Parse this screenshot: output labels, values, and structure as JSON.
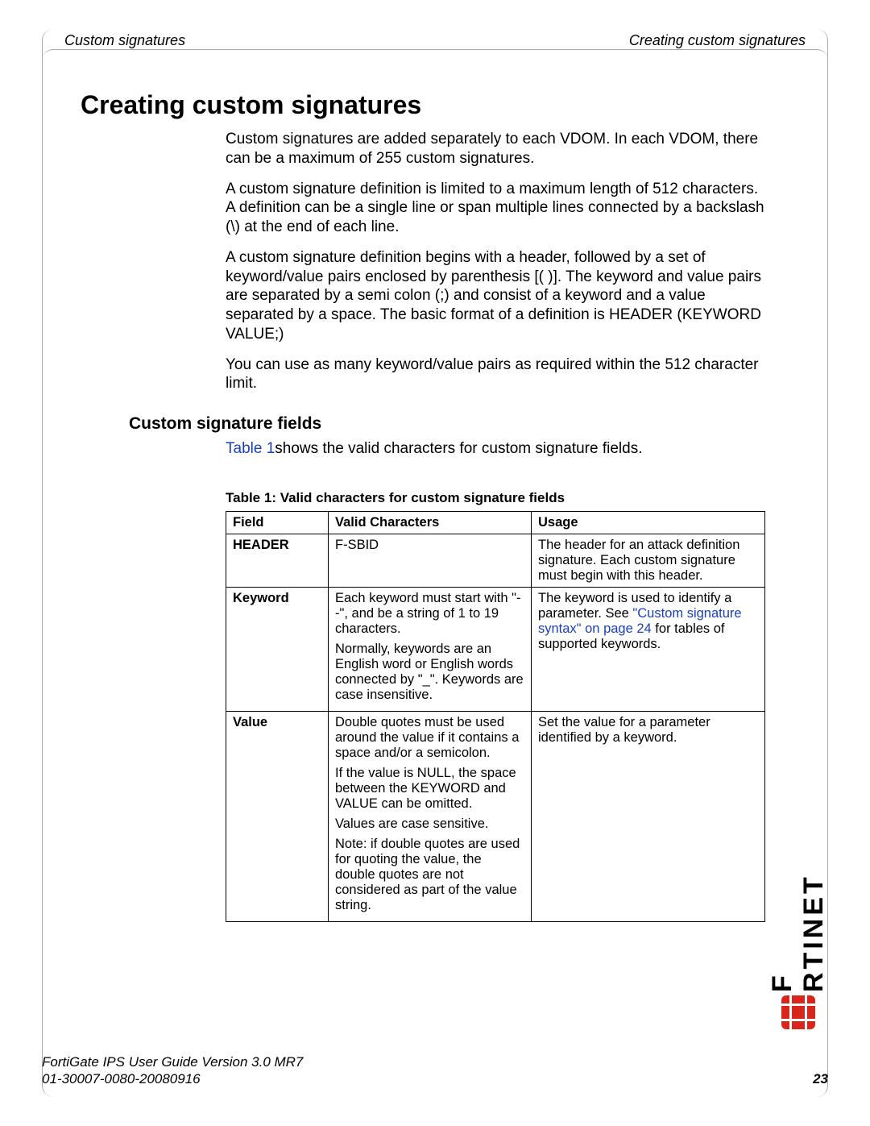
{
  "header": {
    "running_left": "Custom signatures",
    "running_right": "Creating custom signatures"
  },
  "section": {
    "title": "Creating custom signatures",
    "paragraphs": [
      "Custom signatures are added separately to each VDOM. In each VDOM, there can be a maximum of 255 custom signatures.",
      "A custom signature definition is limited to a maximum length of 512 characters. A definition can be a single line or span multiple lines connected by a backslash (\\) at the end of each line.",
      "A custom signature definition begins with a header, followed by a set of keyword/value pairs enclosed by parenthesis [( )]. The keyword and value pairs are separated by a semi colon (;) and consist of a keyword and a value separated by a space. The basic format of a definition is HEADER (KEYWORD VALUE;)",
      "You can use as many keyword/value pairs as required within the 512 character limit."
    ]
  },
  "subsection": {
    "title": "Custom signature fields",
    "ref_prefix": "Table 1",
    "ref_text": "shows the valid characters for custom signature fields."
  },
  "table": {
    "caption": "Table 1: Valid characters for custom signature fields",
    "headers": {
      "field": "Field",
      "valid": "Valid Characters",
      "usage": "Usage"
    },
    "rows": [
      {
        "field": "HEADER",
        "valid": [
          "F-SBID"
        ],
        "usage_plain": "The header for an attack definition signature. Each custom signature must begin with this header.",
        "usage_link": "",
        "usage_after": ""
      },
      {
        "field": "Keyword",
        "valid": [
          "Each keyword must start with \"--\", and be a string of 1 to 19 characters.",
          "Normally, keywords are an English word or English words connected by \"_\". Keywords are case insensitive."
        ],
        "usage_plain": "The keyword is used to identify a parameter. See ",
        "usage_link": "\"Custom signature syntax\" on page 24",
        "usage_after": " for tables of supported keywords."
      },
      {
        "field": "Value",
        "valid": [
          "Double quotes must be used around the value if it contains a space and/or a semicolon.",
          "If the value is NULL, the space between the KEYWORD and VALUE can be omitted.",
          "Values are case sensitive.",
          "Note: if double quotes are used for quoting the value, the double quotes are not considered as part of the value string."
        ],
        "usage_plain": "Set the value for a parameter identified by a keyword.",
        "usage_link": "",
        "usage_after": ""
      }
    ]
  },
  "footer": {
    "line1": "FortiGate IPS User Guide Version 3.0 MR7",
    "line2": "01-30007-0080-20080916",
    "page": "23"
  },
  "brand": {
    "name": "FORTINET",
    "display": "F RTINET"
  }
}
